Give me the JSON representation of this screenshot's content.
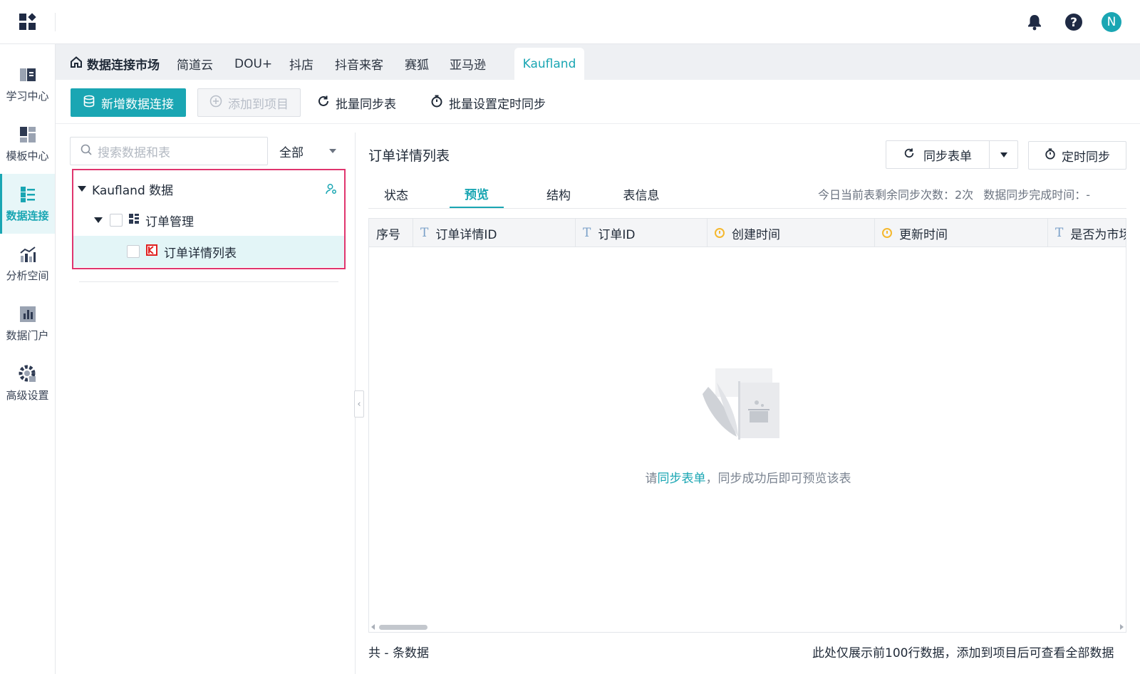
{
  "topbar": {
    "avatar_initial": "N",
    "icons": [
      "app-grid-icon",
      "bell-icon",
      "help-icon"
    ]
  },
  "leftnav": {
    "items": [
      {
        "label": "学习中心",
        "icon": "book-icon"
      },
      {
        "label": "模板中心",
        "icon": "template-icon"
      },
      {
        "label": "数据连接",
        "icon": "data-connect-icon",
        "active": true
      },
      {
        "label": "分析空间",
        "icon": "analysis-icon"
      },
      {
        "label": "数据门户",
        "icon": "portal-icon"
      },
      {
        "label": "高级设置",
        "icon": "settings-icon"
      }
    ]
  },
  "tabs": [
    {
      "label": "数据连接市场",
      "home": true
    },
    {
      "label": "简道云"
    },
    {
      "label": "DOU+"
    },
    {
      "label": "抖店"
    },
    {
      "label": "抖音来客"
    },
    {
      "label": "赛狐"
    },
    {
      "label": "亚马逊"
    },
    {
      "label": "Kaufland",
      "active": true
    }
  ],
  "toolbar": {
    "add_connection": "新增数据连接",
    "add_to_project": "添加到项目",
    "batch_sync": "批量同步表",
    "batch_schedule": "批量设置定时同步"
  },
  "tree": {
    "search_placeholder": "搜索数据和表",
    "filter_value": "全部",
    "root": "Kaufland 数据",
    "group": "订单管理",
    "table": "订单详情列表"
  },
  "detail": {
    "title": "订单详情列表",
    "sync_button": "同步表单",
    "schedule_button": "定时同步",
    "tabs": [
      "状态",
      "预览",
      "结构",
      "表信息"
    ],
    "active_tab": "预览",
    "remaining_label": "今日当前表剩余同步次数：2次",
    "finish_label": "数据同步完成时间：-",
    "columns": [
      {
        "label": "序号",
        "type": "none"
      },
      {
        "label": "订单详情ID",
        "type": "text"
      },
      {
        "label": "订单ID",
        "type": "text"
      },
      {
        "label": "创建时间",
        "type": "time"
      },
      {
        "label": "更新时间",
        "type": "time"
      },
      {
        "label": "是否为市场",
        "type": "text"
      }
    ],
    "empty_prefix": "请",
    "empty_link": "同步表单",
    "empty_suffix": "，同步成功后即可预览该表"
  },
  "footer": {
    "count_label": "共 - 条数据",
    "note": "此处仅展示前100行数据，添加到项目后可查看全部数据"
  },
  "colors": {
    "accent": "#1aa6b3",
    "highlight_border": "#e0356e"
  }
}
